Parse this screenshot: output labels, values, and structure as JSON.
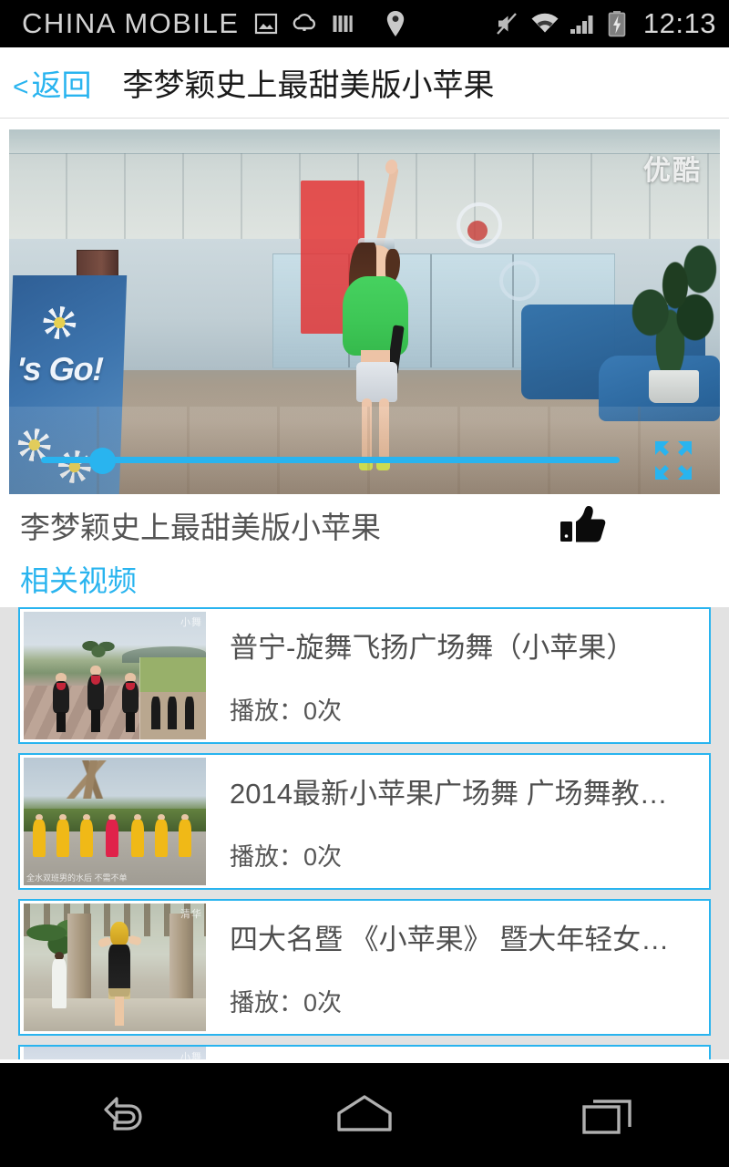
{
  "status_bar": {
    "carrier": "CHINA  MOBILE",
    "clock": "12:13",
    "icons": [
      "image-icon",
      "weather-rain-icon",
      "equalizer-icon",
      "location-pin-icon",
      "mute-icon",
      "wifi-icon",
      "cellular-signal-icon",
      "battery-charging-icon"
    ]
  },
  "header": {
    "back_chevron": "<",
    "back_label": "返回",
    "title": "李梦颖史上最甜美版小苹果"
  },
  "player": {
    "watermark": "优酷",
    "banner_text": "'s Go!",
    "progress_percent": 10.5,
    "accent_color": "#29b4ef",
    "fullscreen_icon": "fullscreen-expand-icon"
  },
  "video_info": {
    "title": "李梦颖史上最甜美版小苹果",
    "like_icon": "thumbs-up-icon"
  },
  "related": {
    "section_title": "相关视频",
    "items": [
      {
        "title": "普宁-旋舞飞扬广场舞（小苹果）",
        "plays": "播放：0次",
        "thumb_label": "小舞",
        "thumb_caption": ""
      },
      {
        "title": "2014最新小苹果广场舞 广场舞教…",
        "plays": "播放：0次",
        "thumb_label": "",
        "thumb_caption": "全水双班男的水后 不需不单"
      },
      {
        "title": "四大名暨 《小苹果》 暨大年轻女…",
        "plays": "播放：0次",
        "thumb_label": "清华",
        "thumb_caption": ""
      },
      {
        "title": "",
        "plays": "",
        "thumb_label": "小舞",
        "thumb_caption": ""
      }
    ]
  },
  "nav_bar": {
    "back_icon": "android-back-icon",
    "home_icon": "android-home-icon",
    "recents_icon": "android-recents-icon"
  }
}
